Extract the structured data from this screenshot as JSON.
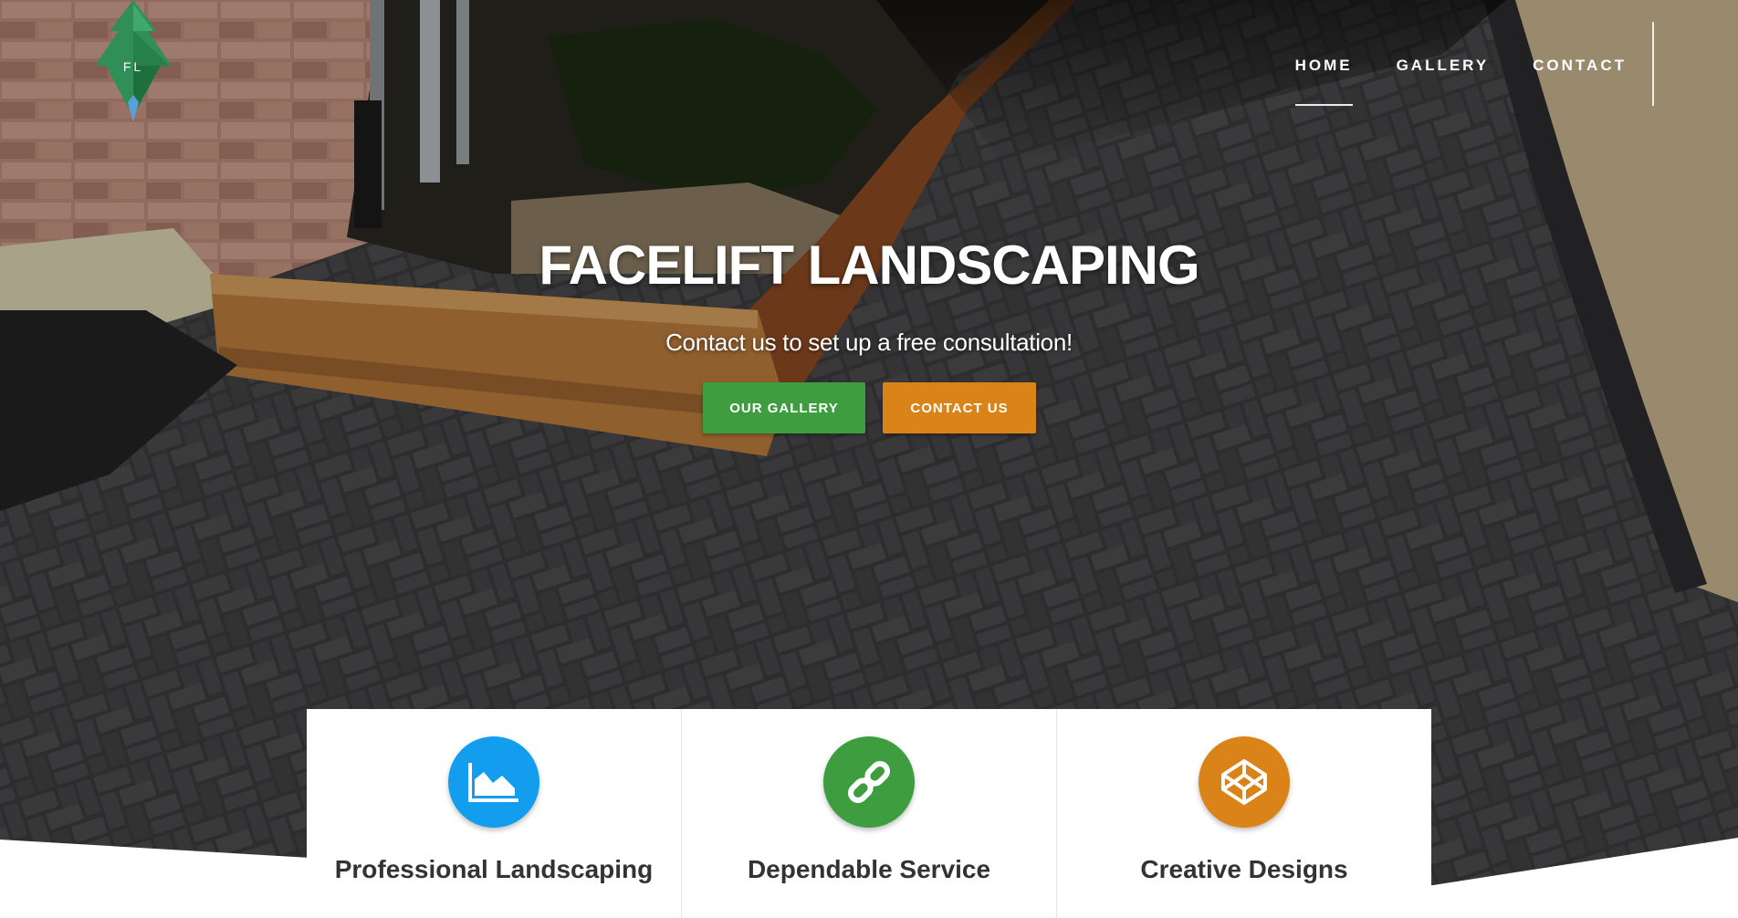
{
  "brand": {
    "logo_text": "FL",
    "logo_icon": "tree-logo-icon"
  },
  "nav": {
    "items": [
      {
        "label": "HOME",
        "active": true
      },
      {
        "label": "GALLERY",
        "active": false
      },
      {
        "label": "CONTACT",
        "active": false
      }
    ]
  },
  "hero": {
    "title": "FACELIFT LANDSCAPING",
    "subtitle": "Contact us to set up a free consultation!",
    "gallery_button": "OUR GALLERY",
    "contact_button": "CONTACT US"
  },
  "features": [
    {
      "title": "Professional Landscaping",
      "icon": "area-chart-icon",
      "color": "#139dee"
    },
    {
      "title": "Dependable Service",
      "icon": "chain-link-icon",
      "color": "#3e9e3f"
    },
    {
      "title": "Creative Designs",
      "icon": "codepen-cube-icon",
      "color": "#d98319"
    }
  ],
  "colors": {
    "green": "#3e9e3f",
    "orange": "#d98319",
    "blue": "#139dee"
  }
}
